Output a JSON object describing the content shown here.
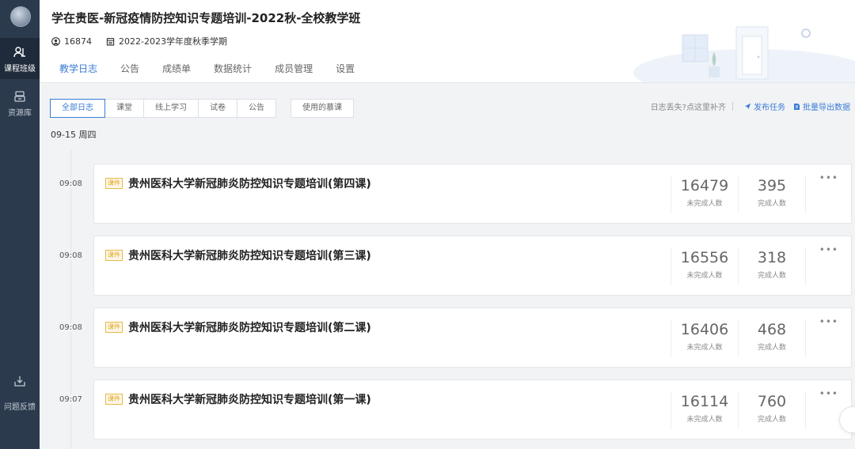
{
  "sidebar": {
    "items": [
      {
        "label": "课程班级",
        "icon": "class-icon",
        "active": true
      },
      {
        "label": "资源库",
        "icon": "resource-icon",
        "active": false
      },
      {
        "label": "问题反馈",
        "icon": "feedback-icon",
        "active": false
      }
    ]
  },
  "header": {
    "title": "学在贵医-新冠疫情防控知识专题培训-2022秋-全校教学班",
    "member_count": "16874",
    "semester": "2022-2023学年度秋季学期",
    "tabs": [
      {
        "label": "教学日志",
        "active": true
      },
      {
        "label": "公告",
        "active": false
      },
      {
        "label": "成绩单",
        "active": false
      },
      {
        "label": "数据统计",
        "active": false
      },
      {
        "label": "成员管理",
        "active": false
      },
      {
        "label": "设置",
        "active": false
      }
    ]
  },
  "filters": {
    "items": [
      "全部日志",
      "课堂",
      "线上学习",
      "试卷",
      "公告"
    ],
    "active_index": 0,
    "mooc_label": "使用的慕课"
  },
  "actions": {
    "missing_hint": "日志丢失?点这里补齐",
    "publish_task": "发布任务",
    "batch_export": "批量导出数据"
  },
  "date_label": "09-15 周四",
  "entries": [
    {
      "time": "09:08",
      "badge": "课件",
      "title": "贵州医科大学新冠肺炎防控知识专题培训(第四课)",
      "incomplete": "16479",
      "incomplete_label": "未完成人数",
      "complete": "395",
      "complete_label": "完成人数"
    },
    {
      "time": "09:08",
      "badge": "课件",
      "title": "贵州医科大学新冠肺炎防控知识专题培训(第三课)",
      "incomplete": "16556",
      "incomplete_label": "未完成人数",
      "complete": "318",
      "complete_label": "完成人数"
    },
    {
      "time": "09:08",
      "badge": "课件",
      "title": "贵州医科大学新冠肺炎防控知识专题培训(第二课)",
      "incomplete": "16406",
      "incomplete_label": "未完成人数",
      "complete": "468",
      "complete_label": "完成人数"
    },
    {
      "time": "09:07",
      "badge": "课件",
      "title": "贵州医科大学新冠肺炎防控知识专题培训(第一课)",
      "incomplete": "16114",
      "incomplete_label": "未完成人数",
      "complete": "760",
      "complete_label": "完成人数"
    }
  ],
  "more_glyph": "•••",
  "colors": {
    "accent": "#3a7bd5",
    "sidebar": "#2b3a4d",
    "badge": "#e0a321"
  }
}
